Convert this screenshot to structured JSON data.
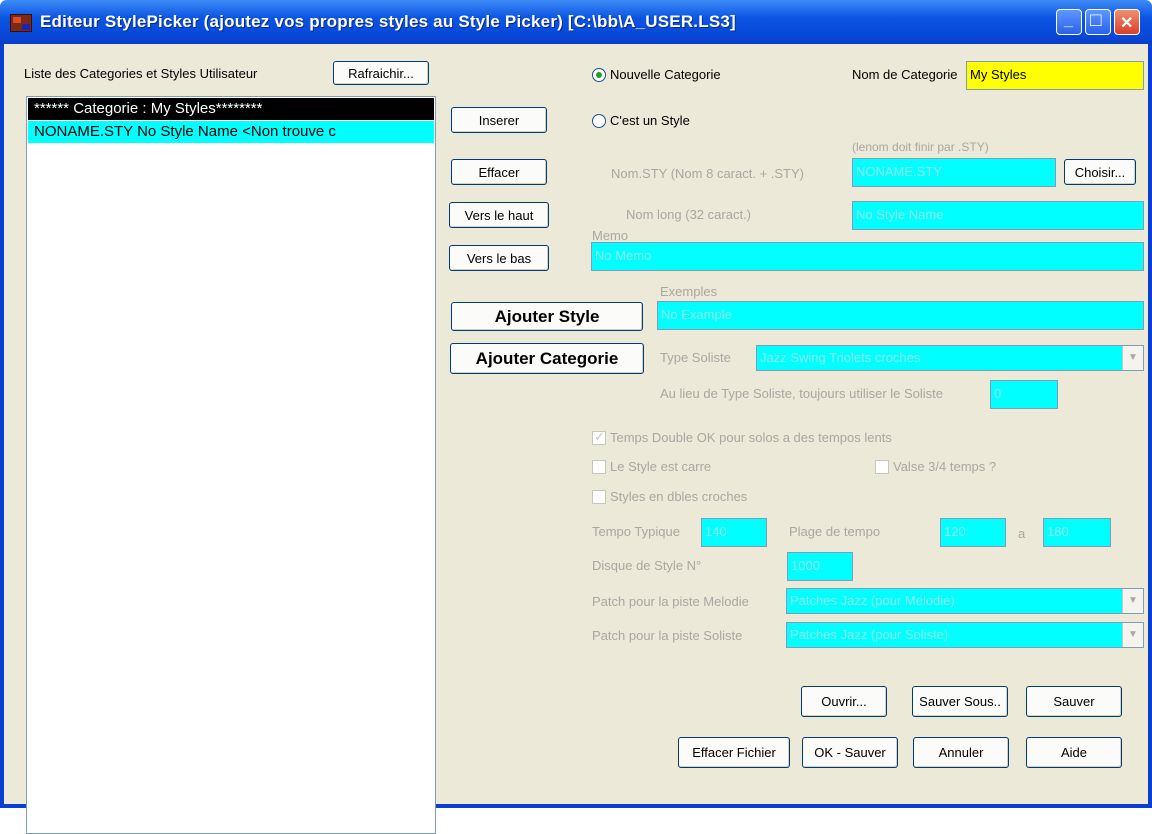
{
  "window": {
    "title": "Editeur StylePicker (ajoutez vos propres styles au Style Picker)     [C:\\bb\\A_USER.LS3]",
    "minimize_symbol": "_",
    "maximize_symbol": "□",
    "close_symbol": "✕"
  },
  "list": {
    "label": "Liste des Categories et Styles Utilisateur",
    "refresh_label": "Rafraichir...",
    "items": [
      "****** Categorie : My Styles********",
      "NONAME.STY   No Style Name   <Non trouve c"
    ]
  },
  "buttons": {
    "insert": "Inserer",
    "delete": "Effacer",
    "up": "Vers le haut",
    "down": "Vers le bas",
    "add_style": "Ajouter Style",
    "add_category": "Ajouter Categorie",
    "choose": "Choisir...",
    "open": "Ouvrir...",
    "save_as": "Sauver Sous..",
    "save": "Sauver",
    "delete_file": "Effacer Fichier",
    "ok_save": "OK - Sauver",
    "cancel": "Annuler",
    "help": "Aide"
  },
  "radios": {
    "new_category": "Nouvelle Categorie",
    "is_style": "C'est un Style"
  },
  "category": {
    "label": "Nom de Categorie",
    "value": "My Styles"
  },
  "style": {
    "sty_hint": "(lenom doit finir par .STY)",
    "sty_label": "Nom.STY  (Nom 8 caract. + .STY)",
    "sty_value": "NONAME.STY",
    "long_label": "Nom long (32 caract.)",
    "long_value": "No Style Name",
    "memo_label": "Memo",
    "memo_value": "No Memo",
    "examples_label": "Exemples",
    "examples_value": "No Example",
    "soloist_type_label": "Type Soliste",
    "soloist_type_value": "Jazz Swing Triolets croches",
    "soloist_instead_label": "Au lieu de Type Soliste, toujours utiliser le Soliste",
    "soloist_instead_value": "0",
    "double_time_label": "Temps Double OK pour solos a des tempos lents",
    "square_label": "Le Style est carre",
    "waltz_label": "Valse 3/4 temps ?",
    "sixteenth_label": "Styles en dbles croches",
    "tempo_label": "Tempo Typique",
    "tempo_value": "140",
    "range_label": "Plage de tempo",
    "range_from": "120",
    "range_a": "a",
    "range_to": "180",
    "disk_label": "Disque de Style N°",
    "disk_value": "1000",
    "melody_patch_label": "Patch pour la piste Melodie",
    "melody_patch_value": "Patches Jazz (pour Melodie)",
    "soloist_patch_label": "Patch pour la piste Soliste",
    "soloist_patch_value": "Patches Jazz (pour Soliste)"
  },
  "colors": {
    "field_bg": "#00ffff",
    "category_bg": "#ffff00",
    "titlebar": "#0846d6"
  }
}
